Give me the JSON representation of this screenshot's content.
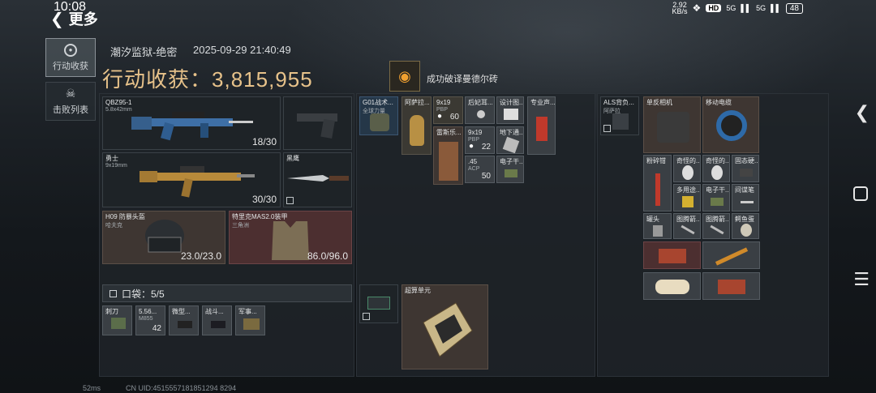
{
  "status_bar": {
    "time": "10:08",
    "net_speed_top": "2.92",
    "net_speed_bottom": "KB/s",
    "hd": "HD",
    "signal_a": "5G",
    "signal_b": "5G",
    "battery": "48"
  },
  "header": {
    "back_label": "更多",
    "location": "潮汐监狱-绝密",
    "datetime": "2025-09-29 21:40:49",
    "harvest_label": "行动收获：",
    "harvest_value": "3,815,955",
    "achievement": "成功破译曼德尔砖"
  },
  "nav": [
    {
      "label": "行动收获",
      "icon": "target-icon"
    },
    {
      "label": "击败列表",
      "icon": "skull-icon"
    }
  ],
  "equipment": {
    "primary": {
      "name": "QBZ95-1",
      "caliber": "5.8x42mm",
      "ammo": "18/30"
    },
    "secondary": {
      "name": "勇士",
      "caliber": "9x19mm",
      "ammo": "30/30"
    },
    "melee": {
      "name": "黑鹰"
    },
    "helmet": {
      "name": "H09 防暴头盔",
      "sub": "哈夫克",
      "durability": "23.0/23.0"
    },
    "armor": {
      "name": "特里克MAS2.0装甲",
      "sub": "三角洲",
      "durability": "86.0/96.0"
    },
    "pocket_label": "口袋：5/5",
    "pocket_items": [
      {
        "label": "刺刀",
        "count": ""
      },
      {
        "label": "5.56...",
        "sub": "M855",
        "count": "42"
      },
      {
        "label": "微型...",
        "count": ""
      },
      {
        "label": "战斗...",
        "count": ""
      },
      {
        "label": "军事...",
        "count": ""
      }
    ]
  },
  "backpack": {
    "items": [
      {
        "label": "G01战术...",
        "sub": "全球力量"
      },
      {
        "label": "阿萨拉..."
      },
      {
        "label": "9x19",
        "sub": "PBP",
        "count": "60"
      },
      {
        "label": "后妃耳..."
      },
      {
        "label": "设计图..."
      },
      {
        "label": "专业声..."
      },
      {
        "label": "雷斯乐..."
      },
      {
        "label": "9x19",
        "sub": "PBP",
        "count": "22"
      },
      {
        "label": "地下通..."
      },
      {
        "label": ".45",
        "sub": "ACP",
        "count": "50"
      },
      {
        "label": "电子干..."
      },
      {
        "label": "超算单元"
      }
    ]
  },
  "chest_rig": {
    "items": [
      {
        "label": "ALS背负...",
        "sub": "阿萨拉"
      },
      {
        "label": "单反相机"
      },
      {
        "label": "移动电缆"
      },
      {
        "label": "粉碎钳"
      },
      {
        "label": "奇怪的..."
      },
      {
        "label": "奇怪的..."
      },
      {
        "label": "固态硬..."
      },
      {
        "label": "多用途..."
      },
      {
        "label": "电子干..."
      },
      {
        "label": "间谍笔"
      },
      {
        "label": "罐头"
      },
      {
        "label": "图腾箭..."
      },
      {
        "label": "图腾箭..."
      },
      {
        "label": "鳄鱼蛋"
      }
    ]
  },
  "footer": {
    "ping": "52ms",
    "uid": "CN UID:4515557181851294 8294"
  },
  "colors": {
    "gold": "#e7c28a",
    "achievement": "#f0a030"
  }
}
